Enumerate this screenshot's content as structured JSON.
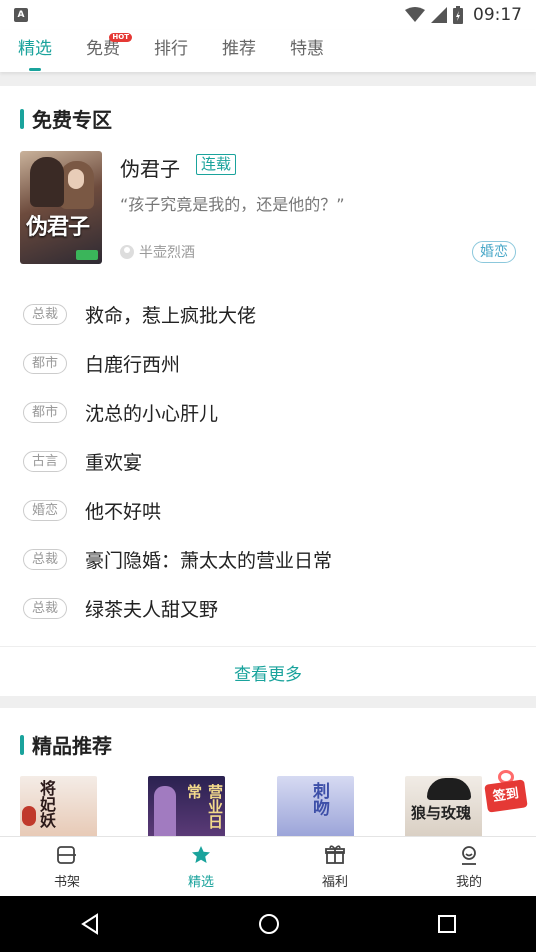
{
  "status_bar": {
    "time": "09:17"
  },
  "tabs": [
    {
      "label": "精选",
      "active": true
    },
    {
      "label": "免费",
      "badge": "HOT"
    },
    {
      "label": "排行"
    },
    {
      "label": "推荐"
    },
    {
      "label": "特惠"
    }
  ],
  "free_zone": {
    "title": "免费专区",
    "featured": {
      "cover_title": "伪君子",
      "title": "伪君子",
      "tag": "连载",
      "description": "“孩子究竟是我的，还是他的？”",
      "author": "半壶烈酒",
      "genre": "婚恋"
    },
    "list": [
      {
        "genre": "总裁",
        "title": "救命，惹上疯批大佬"
      },
      {
        "genre": "都市",
        "title": "白鹿行西州"
      },
      {
        "genre": "都市",
        "title": "沈总的小心肝儿"
      },
      {
        "genre": "古言",
        "title": "重欢宴"
      },
      {
        "genre": "婚恋",
        "title": "他不好哄"
      },
      {
        "genre": "总裁",
        "title": "豪门隐婚：萧太太的营业日常"
      },
      {
        "genre": "总裁",
        "title": "绿茶夫人甜又野"
      }
    ],
    "more_label": "查看更多"
  },
  "premium": {
    "title": "精品推荐",
    "covers": [
      {
        "text": "将妃妖"
      },
      {
        "text": "营业日常"
      },
      {
        "text": "刺吻"
      },
      {
        "text": "狼与玫瑰"
      }
    ],
    "signin_label": "签到"
  },
  "bottom_nav": [
    {
      "label": "书架",
      "icon": "bookshelf-icon"
    },
    {
      "label": "精选",
      "icon": "star-icon",
      "active": true
    },
    {
      "label": "福利",
      "icon": "gift-icon"
    },
    {
      "label": "我的",
      "icon": "profile-icon"
    }
  ],
  "colors": {
    "accent": "#1aa39c",
    "hot_badge": "#e53935",
    "genre_tag": "#4aa8c8"
  }
}
